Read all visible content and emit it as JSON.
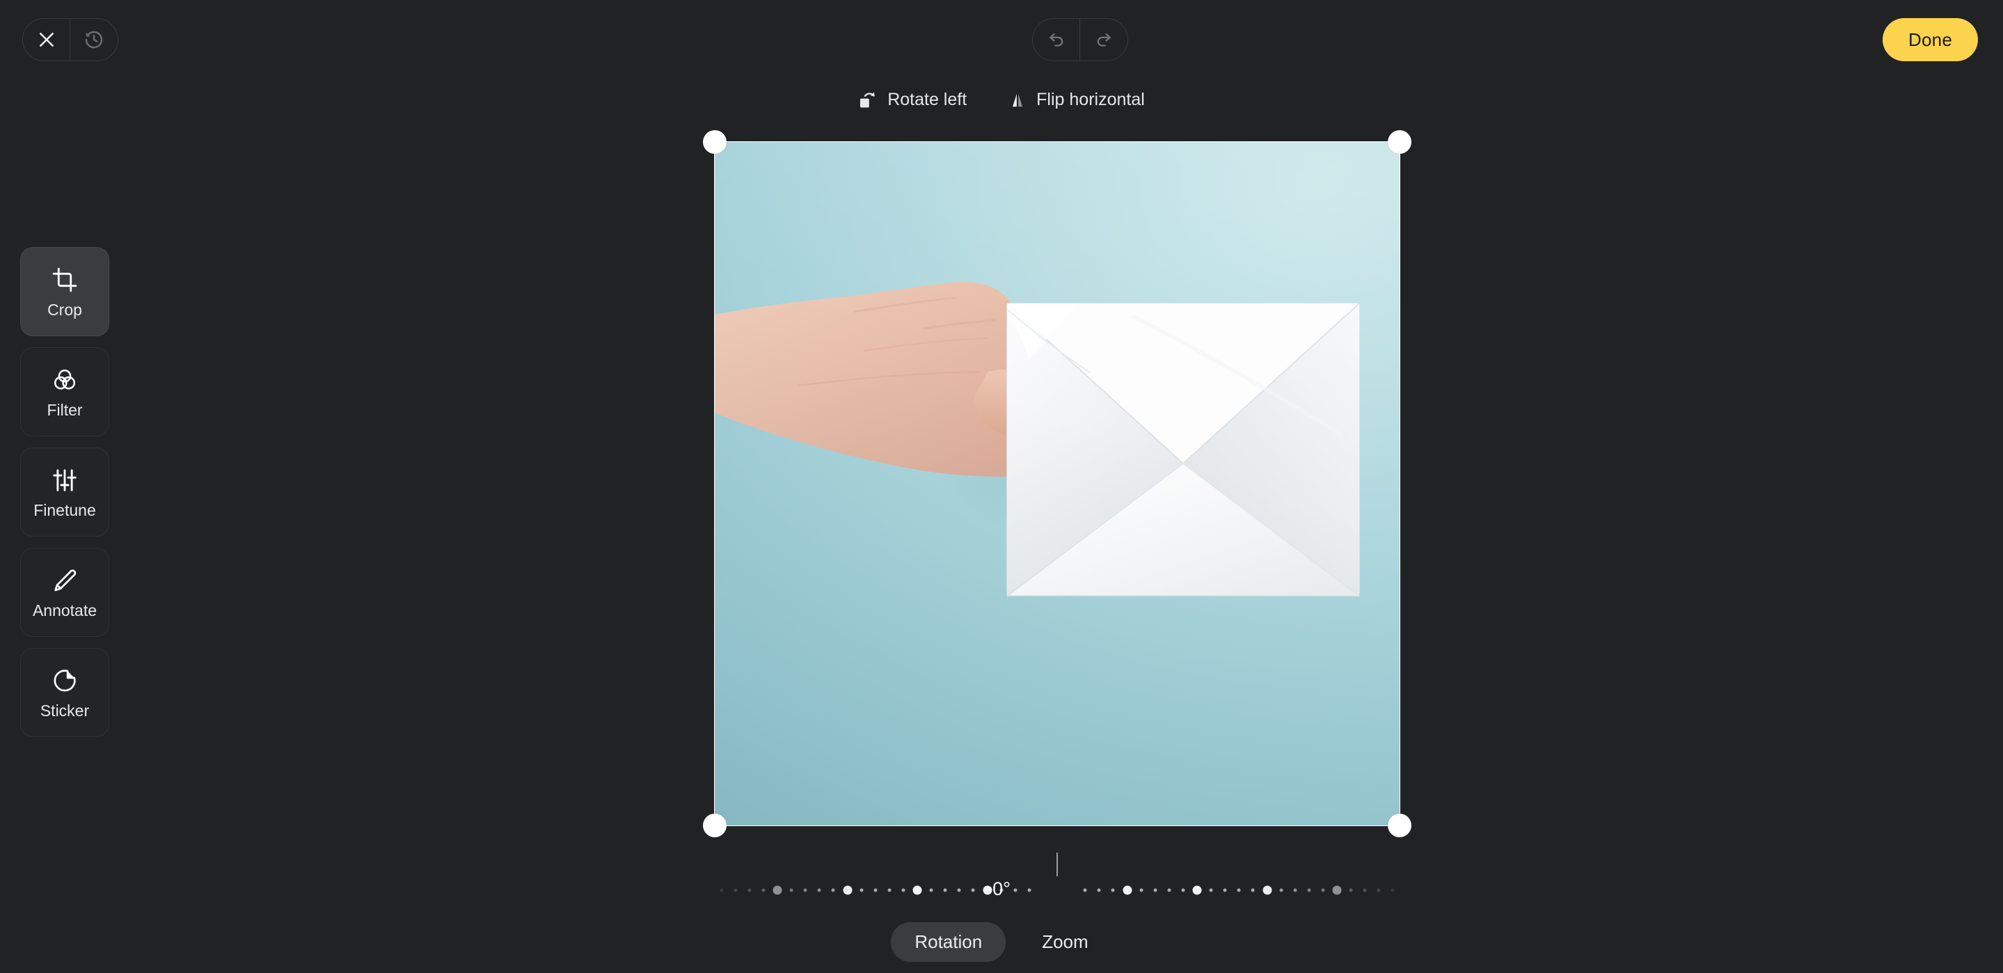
{
  "app": {
    "background_color": "#212223",
    "accent_color": "#FCD34D"
  },
  "header": {
    "close_label": "Close",
    "history_label": "Revert history",
    "undo_label": "Undo",
    "redo_label": "Redo",
    "done_label": "Done"
  },
  "transform_bar": {
    "items": [
      {
        "label": "Rotate left",
        "icon": "rotate-left-icon"
      },
      {
        "label": "Flip horizontal",
        "icon": "flip-horizontal-icon"
      }
    ]
  },
  "tools": [
    {
      "label": "Crop",
      "icon": "crop-icon",
      "active": true
    },
    {
      "label": "Filter",
      "icon": "filter-icon",
      "active": false
    },
    {
      "label": "Finetune",
      "icon": "finetune-icon",
      "active": false
    },
    {
      "label": "Annotate",
      "icon": "annotate-icon",
      "active": false
    },
    {
      "label": "Sticker",
      "icon": "sticker-icon",
      "active": false
    }
  ],
  "canvas": {
    "image_description": "Hand holding a white envelope on a light blue background",
    "background_color": "#b5dbe1",
    "crop_handles": [
      "top-left",
      "top-right",
      "bottom-left",
      "bottom-right"
    ]
  },
  "rotation": {
    "value_label": "0°",
    "value": 0,
    "min": -45,
    "max": 45,
    "tick_count": 49,
    "major_tick_every": 5
  },
  "bottom_tabs": [
    {
      "label": "Rotation",
      "active": true
    },
    {
      "label": "Zoom",
      "active": false
    }
  ]
}
